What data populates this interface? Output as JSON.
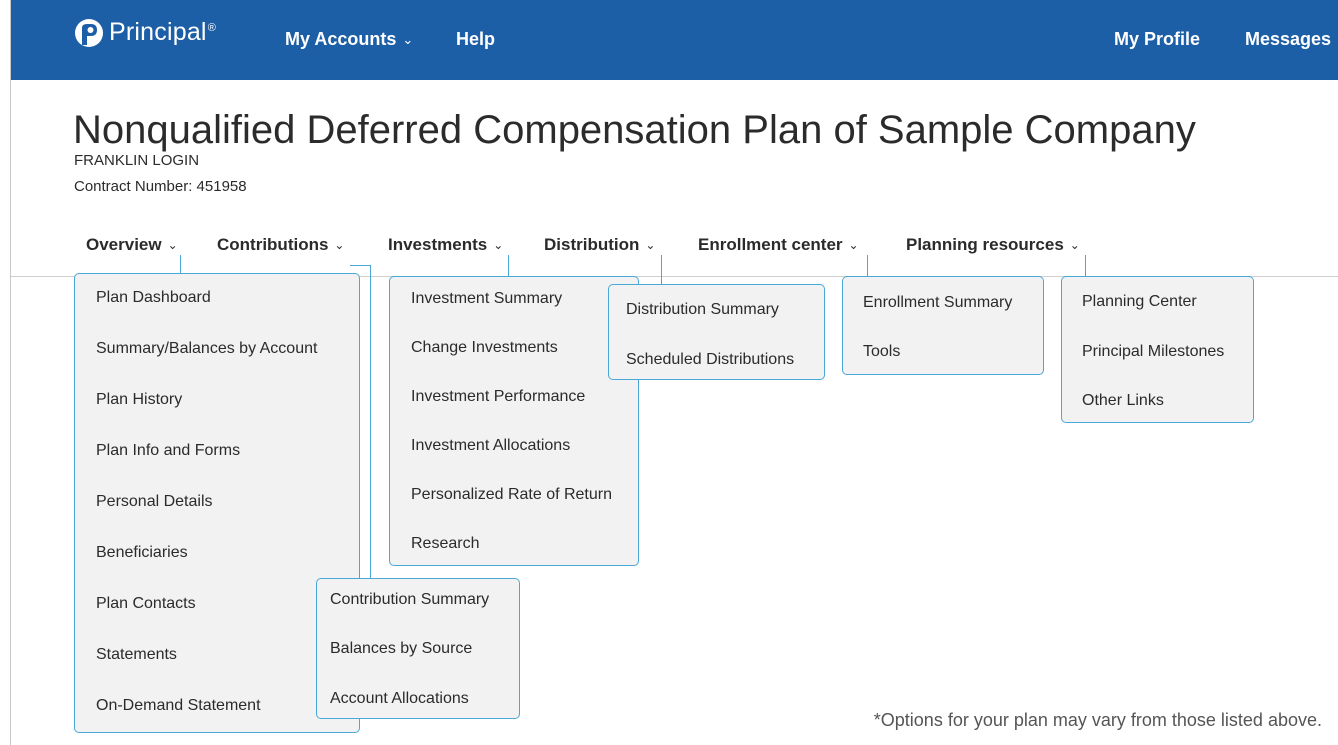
{
  "topbar": {
    "brand": "Principal",
    "brand_mark": "®",
    "nav": [
      "My Accounts",
      "Help"
    ],
    "right": [
      "My Profile",
      "Messages"
    ]
  },
  "header": {
    "title": "Nonqualified Deferred Compensation Plan of Sample Company",
    "user": "FRANKLIN LOGIN",
    "contract": "Contract Number: 451958"
  },
  "mainnav": [
    "Overview",
    "Contributions",
    "Investments",
    "Distribution",
    "Enrollment center",
    "Planning resources"
  ],
  "menus": {
    "overview": [
      "Plan Dashboard",
      "Summary/Balances by Account",
      "Plan History",
      "Plan Info and Forms",
      "Personal Details",
      "Beneficiaries",
      "Plan Contacts",
      "Statements",
      "On-Demand Statement"
    ],
    "contributions": [
      "Contribution Summary",
      "Balances by Source",
      "Account Allocations"
    ],
    "investments": [
      "Investment Summary",
      "Change Investments",
      "Investment Performance",
      "Investment Allocations",
      "Personalized Rate of Return",
      "Research"
    ],
    "distribution": [
      "Distribution Summary",
      "Scheduled Distributions"
    ],
    "enrollment": [
      "Enrollment Summary",
      "Tools"
    ],
    "planning": [
      "Planning Center",
      "Principal Milestones",
      "Other Links"
    ]
  },
  "footnote": "*Options for your plan may vary from those listed above.",
  "colors": {
    "topbar": "#1d5fa6",
    "accent": "#4aa8d8",
    "menu_bg": "#f2f2f2"
  }
}
